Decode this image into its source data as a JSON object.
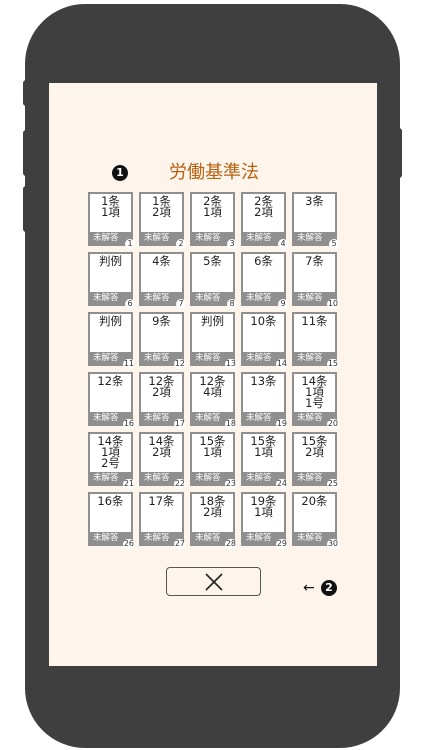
{
  "header": {
    "marker": "1",
    "title": "労働基準法"
  },
  "status_label": "未解答",
  "cards": [
    {
      "label": "1条\n1項",
      "num": "1"
    },
    {
      "label": "1条\n2項",
      "num": "2"
    },
    {
      "label": "2条\n1項",
      "num": "3"
    },
    {
      "label": "2条\n2項",
      "num": "4"
    },
    {
      "label": "3条",
      "num": "5"
    },
    {
      "label": "判例",
      "num": "6"
    },
    {
      "label": "4条",
      "num": "7"
    },
    {
      "label": "5条",
      "num": "8"
    },
    {
      "label": "6条",
      "num": "9"
    },
    {
      "label": "7条",
      "num": "10"
    },
    {
      "label": "判例",
      "num": "11"
    },
    {
      "label": "9条",
      "num": "12"
    },
    {
      "label": "判例",
      "num": "13"
    },
    {
      "label": "10条",
      "num": "14"
    },
    {
      "label": "11条",
      "num": "15"
    },
    {
      "label": "12条",
      "num": "16"
    },
    {
      "label": "12条\n2項",
      "num": "17"
    },
    {
      "label": "12条\n4項",
      "num": "18"
    },
    {
      "label": "13条",
      "num": "19"
    },
    {
      "label": "14条\n1項\n1号",
      "num": "20"
    },
    {
      "label": "14条\n1項\n2号",
      "num": "21"
    },
    {
      "label": "14条\n2項",
      "num": "22"
    },
    {
      "label": "15条\n1項",
      "num": "23"
    },
    {
      "label": "15条\n1項",
      "num": "24"
    },
    {
      "label": "15条\n2項",
      "num": "25"
    },
    {
      "label": "16条",
      "num": "26"
    },
    {
      "label": "17条",
      "num": "27"
    },
    {
      "label": "18条\n2項",
      "num": "28"
    },
    {
      "label": "19条\n1項",
      "num": "29"
    },
    {
      "label": "20条",
      "num": "30"
    }
  ],
  "footer": {
    "close_icon": "x-icon",
    "arrow": "←",
    "marker": "2"
  }
}
